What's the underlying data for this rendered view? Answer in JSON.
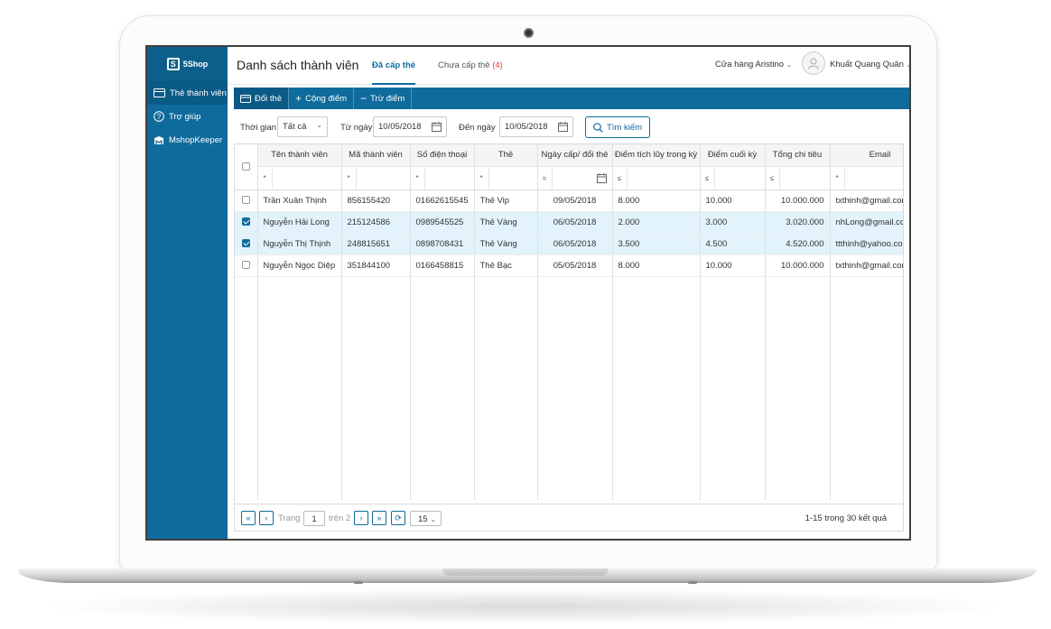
{
  "app": {
    "logo": "5Shop"
  },
  "sidebar": {
    "items": [
      {
        "label": "Thẻ thành viên",
        "icon": "card-icon",
        "active": true
      },
      {
        "label": "Trợ giúp",
        "icon": "help-icon",
        "active": false
      },
      {
        "label": "MshopKeeper",
        "icon": "mshopkeeper-icon",
        "active": false
      }
    ]
  },
  "header": {
    "title": "Danh sách thành viên",
    "tabs": [
      {
        "label": "Đã cấp thẻ",
        "active": true
      },
      {
        "label": "Chưa cấp thẻ",
        "count": "(4)",
        "active": false
      }
    ],
    "store": "Cửa hàng Aristino",
    "user": "Khuất Quang Quân"
  },
  "toolbar": {
    "change_card": "Đổi thẻ",
    "add_points": "Cộng điểm",
    "subtract_points": "Trừ điểm"
  },
  "filters": {
    "time_label": "Thời gian",
    "time_value": "Tất cả",
    "from_label": "Từ ngày",
    "from_value": "10/05/2018",
    "to_label": "Đến ngày",
    "to_value": "10/05/2018",
    "search": "Tìm kiếm"
  },
  "table": {
    "columns": [
      "Tên thành viên",
      "Mã thành viên",
      "Số điện thoại",
      "Thẻ",
      "Ngày cấp/ đổi thẻ",
      "Điểm tích lũy trong kỳ",
      "Điểm cuối kỳ",
      "Tổng chi tiêu",
      "Email"
    ],
    "filter_ops": [
      "*",
      "*",
      "*",
      "*",
      "=",
      "≤",
      "≤",
      "≤",
      "*"
    ],
    "rows": [
      {
        "checked": false,
        "name": "Trần Xuân Thịnh",
        "code": "856155420",
        "phone": "01662615545",
        "card": "Thẻ Vip",
        "date": "09/05/2018",
        "points": "8.000",
        "end_points": "10.000",
        "total": "10.000.000",
        "email": "txthinh@gmail.com"
      },
      {
        "checked": true,
        "name": "Nguyễn Hải Long",
        "code": "215124586",
        "phone": "0989545525",
        "card": "Thẻ Vàng",
        "date": "06/05/2018",
        "points": "2.000",
        "end_points": "3.000",
        "total": "3.020.000",
        "email": "nhLong@gmail.com"
      },
      {
        "checked": true,
        "name": "Nguyễn Thị Thịnh",
        "code": "248815651",
        "phone": "0898708431",
        "card": "Thẻ Vàng",
        "date": "06/05/2018",
        "points": "3.500",
        "end_points": "4.500",
        "total": "4.520.000",
        "email": "ttthinh@yahoo.com"
      },
      {
        "checked": false,
        "name": "Nguyễn Ngọc Diệp",
        "code": "351844100",
        "phone": "0166458815",
        "card": "Thẻ Bạc",
        "date": "05/05/2018",
        "points": "8.000",
        "end_points": "10.000",
        "total": "10.000.000",
        "email": "txthinh@gmail.com"
      }
    ]
  },
  "pager": {
    "page_label": "Trang",
    "page": "1",
    "of_label": "trên 2",
    "page_size": "15",
    "result": "1-15 trong 30 kết quả"
  },
  "colors": {
    "primary": "#0f6b9c",
    "selected_row": "#e2f3fb",
    "count": "#e03a3a"
  }
}
